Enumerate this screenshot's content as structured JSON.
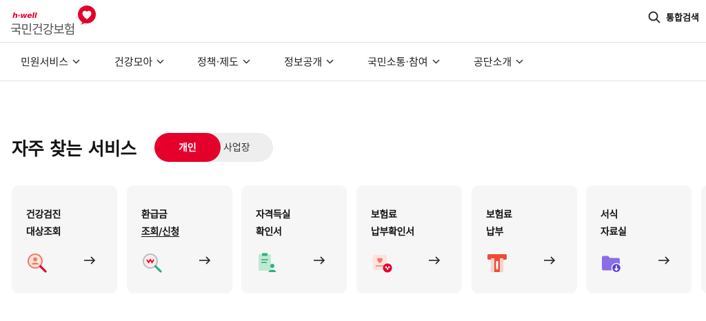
{
  "header": {
    "logo_brand": "h·well",
    "logo_org": "국민건강보험",
    "search_label": "통합검색"
  },
  "nav": {
    "items": [
      {
        "label": "민원서비스"
      },
      {
        "label": "건강모아"
      },
      {
        "label": "정책·제도"
      },
      {
        "label": "정보공개"
      },
      {
        "label": "국민소통·참여"
      },
      {
        "label": "공단소개"
      }
    ]
  },
  "section": {
    "title": "자주 찾는 서비스",
    "toggle": {
      "active_label": "개인",
      "inactive_label": "사업장"
    }
  },
  "cards": [
    {
      "line1": "건강검진",
      "line2": "대상조회",
      "icon": "person-search-icon"
    },
    {
      "line1": "환급금",
      "line2": "조회/신청",
      "icon": "refund-search-icon"
    },
    {
      "line1": "자격득실",
      "line2": "확인서",
      "icon": "certificate-person-icon"
    },
    {
      "line1": "보험료",
      "line2": "납부확인서",
      "icon": "premium-receipt-icon"
    },
    {
      "line1": "보험료",
      "line2": "납부",
      "icon": "payment-machine-icon"
    },
    {
      "line1": "서식",
      "line2": "자료실",
      "icon": "folder-download-icon"
    }
  ],
  "colors": {
    "accent": "#e4002b",
    "card_bg": "#f6f6f6"
  }
}
